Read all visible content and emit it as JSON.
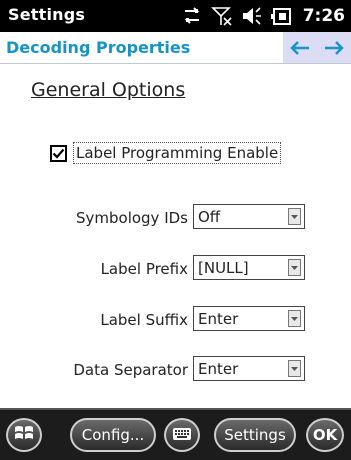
{
  "statusbar": {
    "title": "Settings",
    "time": "7:26",
    "icons": [
      "connectivity-icon",
      "no-signal-icon",
      "volume-icon",
      "battery-charging-icon"
    ]
  },
  "header": {
    "title": "Decoding Properties",
    "back_icon": "arrow-left-icon",
    "forward_icon": "arrow-right-icon",
    "accent": "#1793c8"
  },
  "main": {
    "section_title": "General Options",
    "checkbox": {
      "label": "Label Programming Enable",
      "checked": true
    },
    "fields": [
      {
        "label": "Symbology IDs",
        "value": "Off"
      },
      {
        "label": "Label Prefix",
        "value": "[NULL]"
      },
      {
        "label": "Label Suffix",
        "value": "Enter"
      },
      {
        "label": "Data Separator",
        "value": "Enter"
      }
    ]
  },
  "bottombar": {
    "start_icon": "windows-start-icon",
    "config_label": "Config...",
    "keyboard_icon": "keyboard-icon",
    "settings_label": "Settings",
    "ok_label": "OK"
  }
}
